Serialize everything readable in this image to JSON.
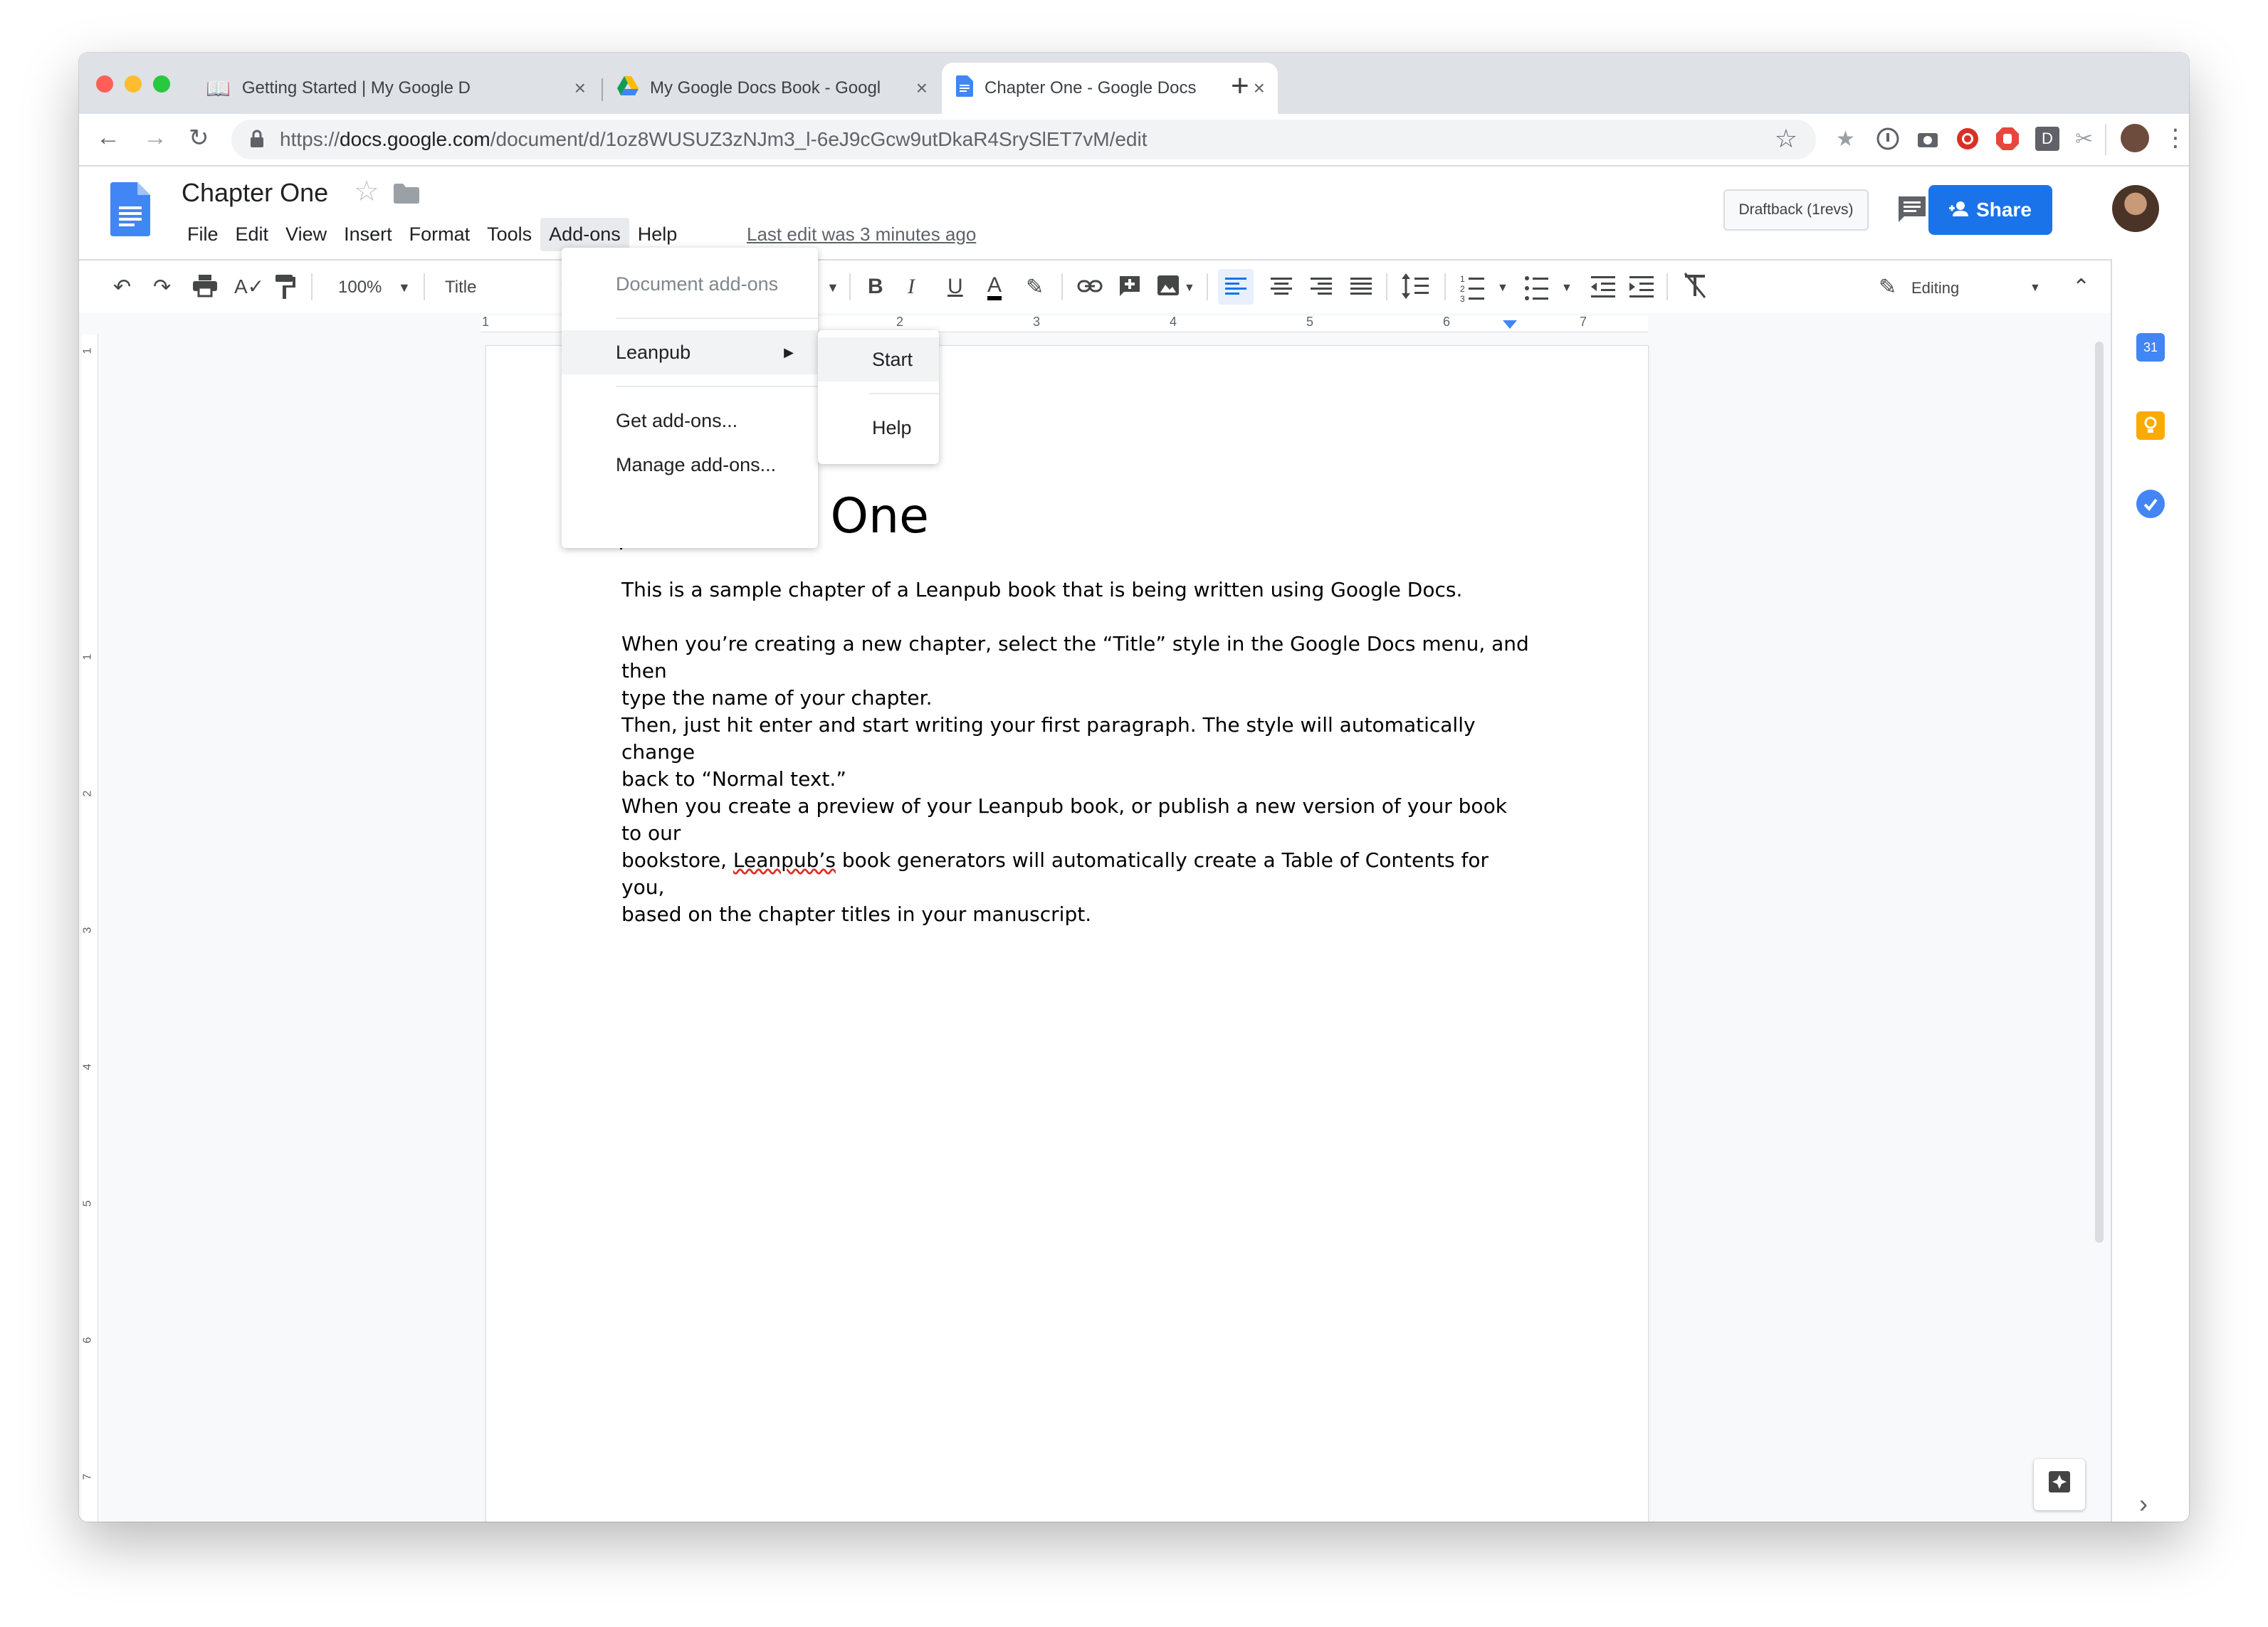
{
  "browser": {
    "tabs": [
      {
        "title": "Getting Started | My Google D",
        "icon": "book-icon"
      },
      {
        "title": "My Google Docs Book - Googl",
        "icon": "drive-icon"
      },
      {
        "title": "Chapter One - Google Docs",
        "icon": "docs-icon"
      }
    ],
    "url_prefix": "https://",
    "url_host": "docs.google.com",
    "url_path": "/document/d/1oz8WUSUZ3zNJm3_l-6eJ9cGcw9utDkaR4SrySlET7vM/edit"
  },
  "doc": {
    "title": "Chapter One",
    "menus": [
      "File",
      "Edit",
      "View",
      "Insert",
      "Format",
      "Tools",
      "Add-ons",
      "Help"
    ],
    "last_edit": "Last edit was 3 minutes ago",
    "draftback": "Draftback (1revs)",
    "share": "Share"
  },
  "toolbar": {
    "zoom": "100%",
    "style": "Title",
    "mode": "Editing",
    "bold": "B",
    "italic": "I",
    "underline": "U",
    "text_color": "A"
  },
  "ruler": [
    "1",
    "1",
    "2",
    "3",
    "4",
    "5",
    "6",
    "7"
  ],
  "vruler": [
    "1",
    "1",
    "2",
    "3",
    "4",
    "5",
    "6",
    "7"
  ],
  "addons_menu": {
    "header": "Document add-ons",
    "leanpub": "Leanpub",
    "get": "Get add-ons...",
    "manage": "Manage add-ons..."
  },
  "leanpub_submenu": {
    "start": "Start",
    "help": "Help"
  },
  "content": {
    "heading": "Chapter One",
    "p1": "This is a sample chapter of a Leanpub book that is being written using Google Docs.",
    "p2a": "When you’re creating a new chapter, select the “Title” style in the Google Docs menu, and then",
    "p2b": "type the name of your chapter.",
    "p3a": "Then, just hit enter and start writing your first paragraph. The style will automatically change",
    "p3b": "back to “Normal text.”",
    "p4a": "When you create a preview of your Leanpub book, or publish a new version of your book to our",
    "p4b_pre": "bookstore,",
    "p4b_spell": "Leanpub’s",
    "p4b_post": "book generators will automatically create a Table of Contents for you,",
    "p4c": "based on the chapter titles in your manuscript."
  },
  "side": {
    "calendar_day": "31"
  },
  "colors": {
    "accent": "#1a73e8",
    "docs_blue": "#4285f4",
    "keep_yellow": "#f9ab00"
  }
}
